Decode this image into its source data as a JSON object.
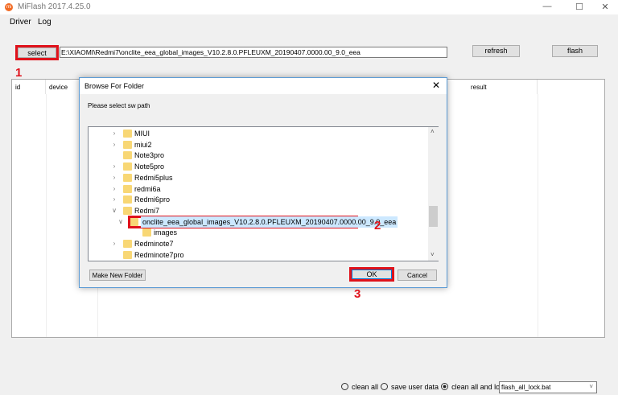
{
  "app": {
    "title": "MiFlash 2017.4.25.0",
    "icon_text": "mi"
  },
  "menu": [
    "Driver",
    "Log"
  ],
  "toolbar": {
    "select": "select",
    "path": "E:\\XIAOMI\\Redmi7\\onclite_eea_global_images_V10.2.8.0.PFLEUXM_20190407.0000.00_9.0_eea",
    "refresh": "refresh",
    "flash": "flash"
  },
  "grid": {
    "columns": [
      "id",
      "device",
      "result"
    ]
  },
  "annotations": [
    "1",
    "2",
    "3"
  ],
  "dialog": {
    "title": "Browse For Folder",
    "prompt": "Please select sw path",
    "new_folder": "Make New Folder",
    "ok": "OK",
    "cancel": "Cancel",
    "tree": [
      {
        "label": "MIUI",
        "level": 1,
        "chevron": "right"
      },
      {
        "label": "miui2",
        "level": 1,
        "chevron": "right"
      },
      {
        "label": "Note3pro",
        "level": 1,
        "chevron": ""
      },
      {
        "label": "Note5pro",
        "level": 1,
        "chevron": "right"
      },
      {
        "label": "Redmi5plus",
        "level": 1,
        "chevron": "right"
      },
      {
        "label": "redmi6a",
        "level": 1,
        "chevron": "right"
      },
      {
        "label": "Redmi6pro",
        "level": 1,
        "chevron": "right"
      },
      {
        "label": "Redmi7",
        "level": 1,
        "chevron": "down"
      },
      {
        "label": "onclite_eea_global_images_V10.2.8.0.PFLEUXM_20190407.0000.00_9.0_eea",
        "level": 2,
        "chevron": "down",
        "selected": true
      },
      {
        "label": "images",
        "level": 3,
        "chevron": ""
      },
      {
        "label": "Redminote7",
        "level": 1,
        "chevron": "right"
      },
      {
        "label": "Redminote7pro",
        "level": 1,
        "chevron": ""
      }
    ]
  },
  "bottom": {
    "options": [
      "clean all",
      "save user data",
      "clean all and lock"
    ],
    "selected": 2,
    "script": "flash_all_lock.bat"
  }
}
